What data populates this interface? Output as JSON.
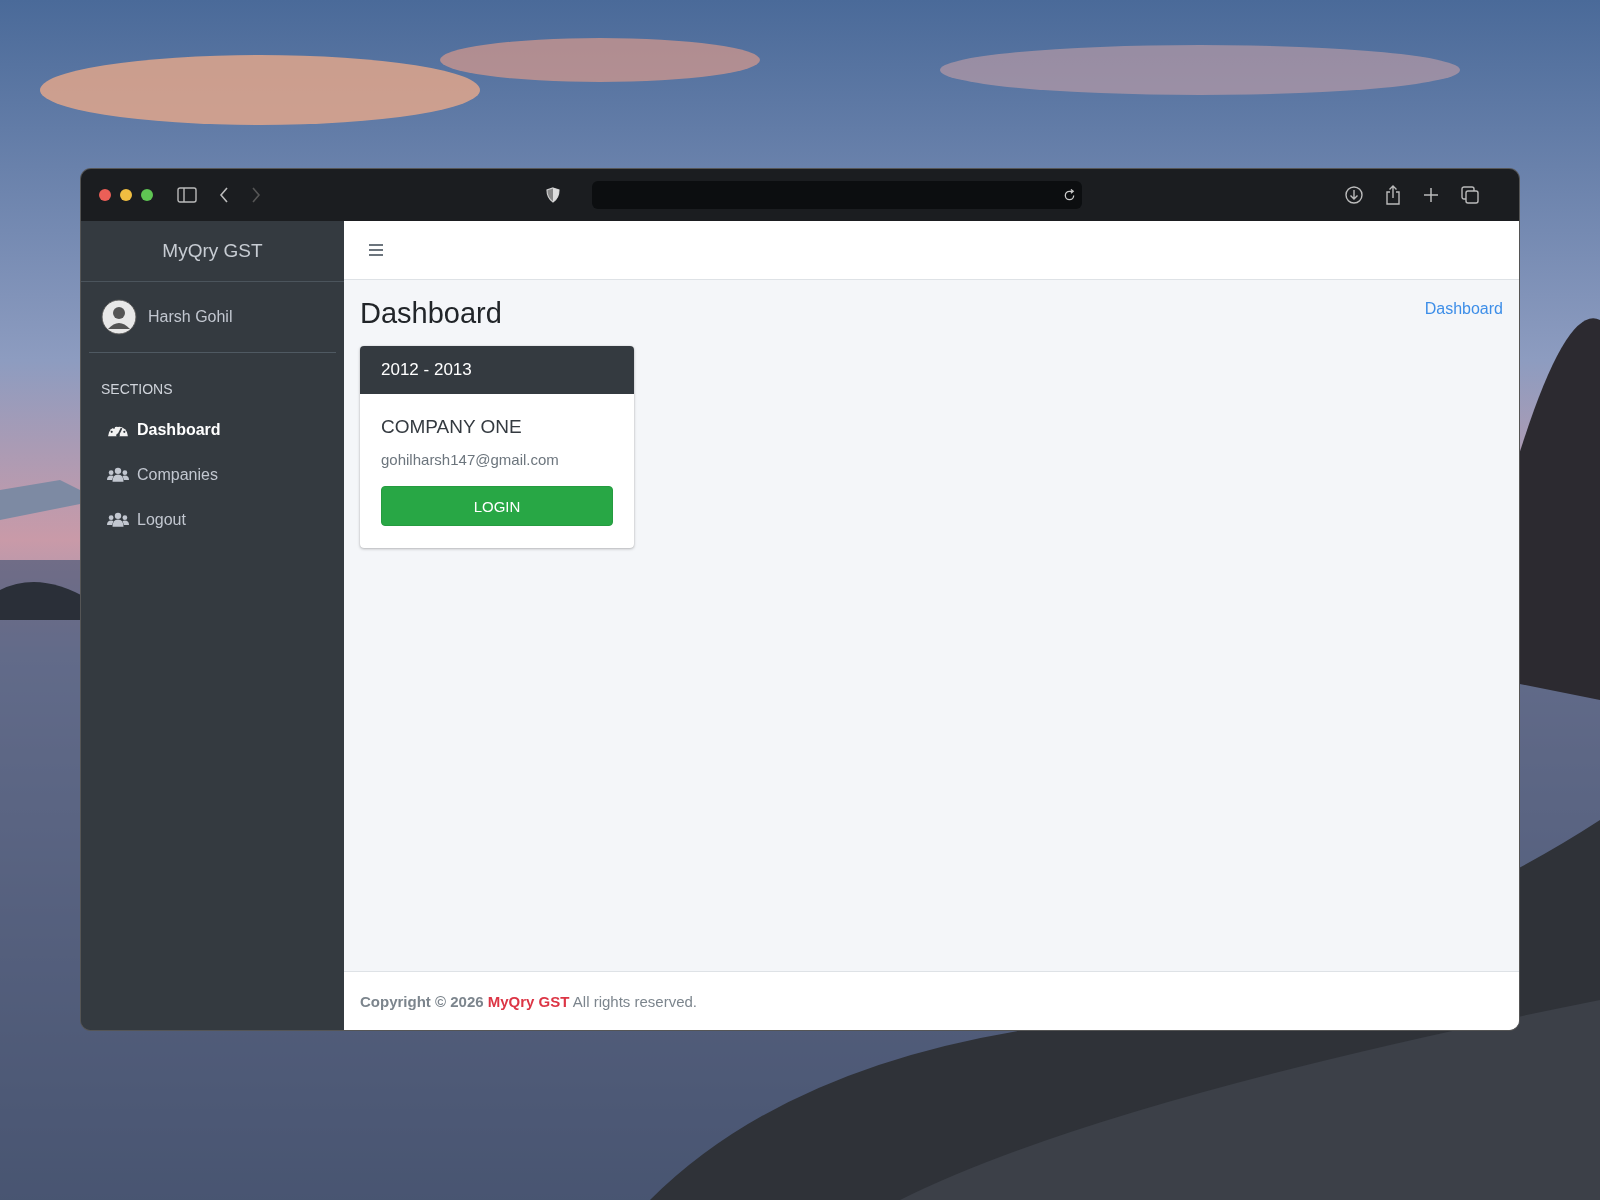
{
  "sidebar": {
    "brand": "MyQry GST",
    "user": {
      "name": "Harsh Gohil"
    },
    "section_title": "SECTIONS",
    "items": [
      {
        "label": "Dashboard",
        "selected": true
      },
      {
        "label": "Companies",
        "selected": false
      },
      {
        "label": "Logout",
        "selected": false
      }
    ]
  },
  "page": {
    "title": "Dashboard",
    "breadcrumb": "Dashboard"
  },
  "cards": [
    {
      "header": "2012 - 2013",
      "company": "COMPANY ONE",
      "email": "gohilharsh147@gmail.com",
      "button": "LOGIN"
    }
  ],
  "footer": {
    "prefix": "**Copyright © 2026**",
    "link": "MyQry GST",
    "suffix": "All rights reserved."
  }
}
